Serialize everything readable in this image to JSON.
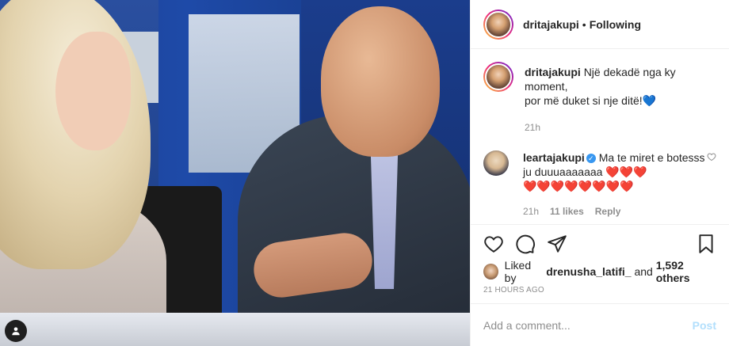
{
  "post": {
    "author": "dritajakupi",
    "separator": "•",
    "follow_status": "Following",
    "caption_line1": "Një dekadë nga ky moment,",
    "caption_line2": "por më duket si nje ditë!💙",
    "caption_time": "21h"
  },
  "comment": {
    "user": "leartajakupi",
    "verified": true,
    "text_line1": "Ma te miret e botesss ju duuuaaaaaaa ❤️❤️❤️",
    "text_line2": "❤️❤️❤️❤️❤️❤️❤️❤️",
    "time": "21h",
    "likes": "11 likes",
    "reply_label": "Reply"
  },
  "likes": {
    "prefix": "Liked by",
    "liker": "drenusha_latifi_",
    "joiner": "and",
    "others": "1,592 others"
  },
  "timestamp": "21 HOURS AGO",
  "add_comment": {
    "placeholder": "Add a comment...",
    "post_label": "Post"
  },
  "icons": [
    "heart-icon",
    "comment-icon",
    "share-icon",
    "bookmark-icon",
    "user-tag-icon",
    "verified-icon"
  ],
  "colors": {
    "link_blue": "#3897f0",
    "post_disabled": "#b2dffc",
    "meta_gray": "#8e8e8e"
  }
}
